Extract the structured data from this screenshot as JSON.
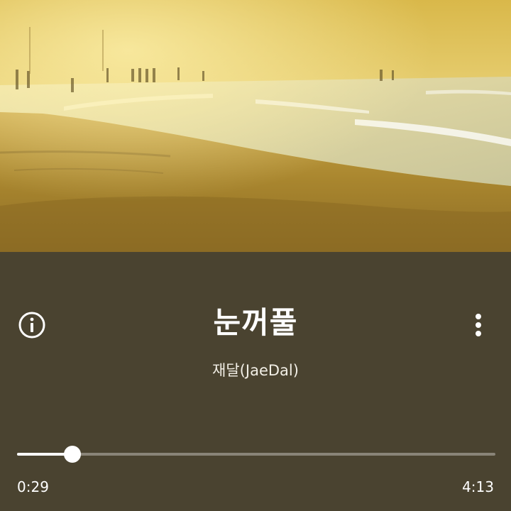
{
  "colors": {
    "panel": "#4a4330",
    "accent": "#ffffff",
    "track": "rgba(255,255,255,0.35)"
  },
  "artwork": {
    "subject": "sunlit beach with waves and distant people"
  },
  "icons": {
    "info": "info-icon",
    "more": "more-vertical-icon"
  },
  "song": {
    "title": "눈꺼풀",
    "artist": "재달(JaeDal)"
  },
  "playback": {
    "elapsed": "0:29",
    "total": "4:13",
    "progress": 0.115
  }
}
